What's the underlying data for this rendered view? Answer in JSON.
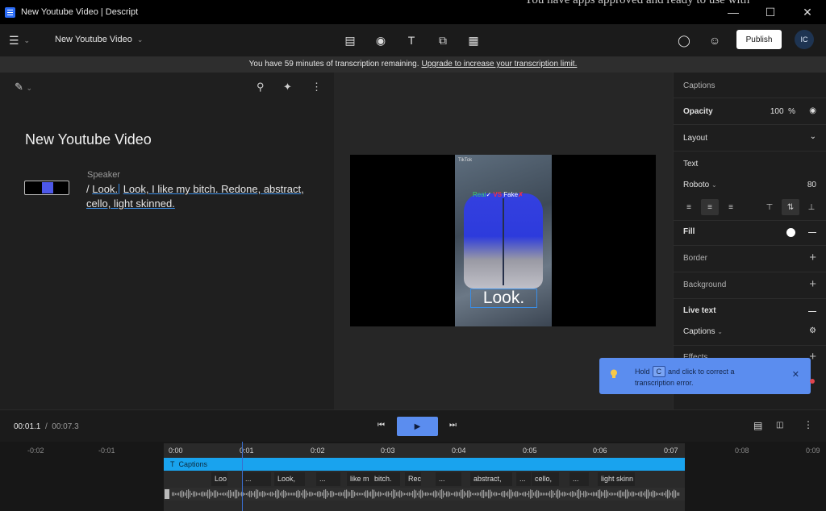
{
  "window": {
    "title": "New Youtube Video | Descript",
    "behind_text": "You have apps approved and ready to use with"
  },
  "toolbar": {
    "doc_title": "New Youtube Video",
    "publish_label": "Publish",
    "avatar_initials": "IC"
  },
  "banner": {
    "text": "You have 59 minutes of transcription remaining.",
    "link": "Upgrade to increase your transcription limit."
  },
  "script": {
    "heading": "New Youtube Video",
    "speaker": "Speaker",
    "slash": "/",
    "words_first": "Look.",
    "words_rest_line1": "Look, I like my bitch. Redone, abstract,",
    "words_line2": "cello, light skinned."
  },
  "preview": {
    "tiktok_label": "TikTok",
    "overlay_real": "Real",
    "overlay_vs": "VS",
    "overlay_fake": "Fake",
    "caption": "Look."
  },
  "properties": {
    "header": "Captions",
    "opacity_label": "Opacity",
    "opacity_value": "100",
    "opacity_unit": "%",
    "layout_label": "Layout",
    "text_label": "Text",
    "font_name": "Roboto",
    "font_size": "80",
    "fill_label": "Fill",
    "border_label": "Border",
    "background_label": "Background",
    "live_text_label": "Live text",
    "captions_select": "Captions",
    "effects_label": "Effects"
  },
  "tooltip": {
    "hold": "Hold",
    "key": "C",
    "rest1": "and click to correct a",
    "rest2": "transcription error."
  },
  "transport": {
    "current_time": "00:01.1",
    "separator": "/",
    "total_time": "00:07.3"
  },
  "timeline": {
    "ruler": [
      "-0:02",
      "-0:01",
      "0:00",
      "0:01",
      "0:02",
      "0:03",
      "0:04",
      "0:05",
      "0:06",
      "0:07",
      "0:08",
      "0:09"
    ],
    "caption_track_label": "Captions",
    "words": [
      "Loo",
      "...",
      "Look,",
      "...",
      "like m",
      "bitch.",
      "Rec",
      "...",
      "abstract,",
      "...",
      "cello,",
      "...",
      "light skinn"
    ]
  }
}
